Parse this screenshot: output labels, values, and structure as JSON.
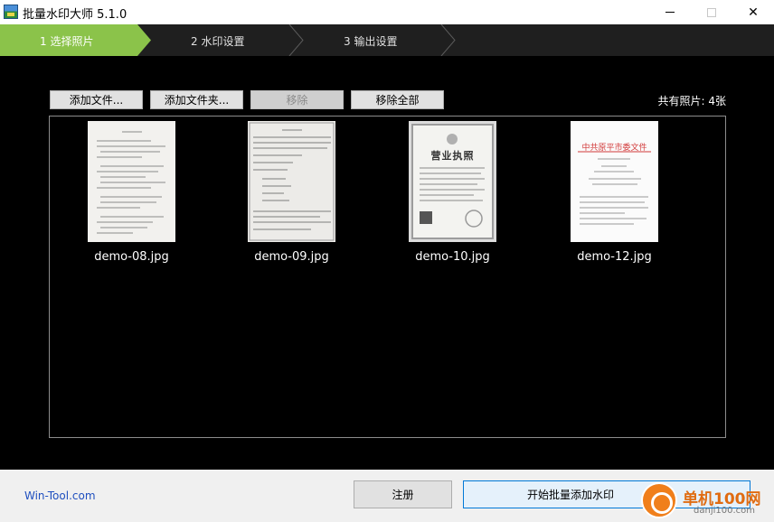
{
  "window": {
    "title": "批量水印大师 5.1.0"
  },
  "steps": [
    {
      "label": "1 选择照片",
      "active": true
    },
    {
      "label": "2 水印设置",
      "active": false
    },
    {
      "label": "3 输出设置",
      "active": false
    }
  ],
  "toolbar": {
    "add_file": "添加文件...",
    "add_folder": "添加文件夹...",
    "remove": "移除",
    "remove_all": "移除全部",
    "photo_count": "共有照片: 4张"
  },
  "files": [
    {
      "name": "demo-08.jpg"
    },
    {
      "name": "demo-09.jpg"
    },
    {
      "name": "demo-10.jpg",
      "heading": "营业执照"
    },
    {
      "name": "demo-12.jpg",
      "heading": "中共原平市委文件"
    }
  ],
  "footer": {
    "link": "Win-Tool.com",
    "register": "注册",
    "start": "开始批量添加水印"
  },
  "watermark": {
    "brand": "单机100网",
    "url": "danji100.com"
  },
  "colors": {
    "step_active": "#8bc34a",
    "background": "#000000",
    "link": "#1f4fbf",
    "primary_border": "#0078d7"
  }
}
